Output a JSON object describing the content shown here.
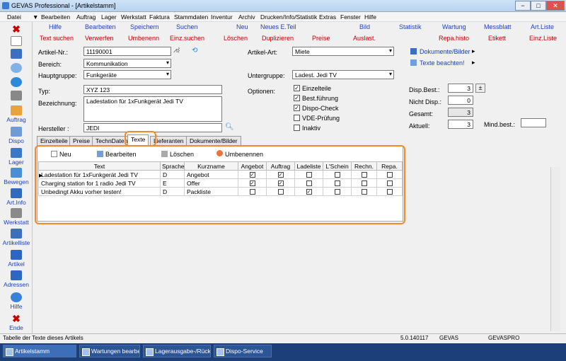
{
  "window": {
    "title": "GEVAS Professional - [Artikelstamm]",
    "min": "−",
    "max": "□",
    "close": "✕"
  },
  "menu": [
    "Datei",
    "▼",
    "Bearbeiten",
    "Auftrag",
    "Lager",
    "Werkstatt",
    "Faktura",
    "Stammdaten",
    "Inventur",
    "Archiv",
    "Drucken/Info/Statistik",
    "Extras",
    "Fenster",
    "Hilfe"
  ],
  "toolbar": {
    "row1": [
      "Hilfe",
      "Bearbeiten",
      "Speichern",
      "Suchen",
      "Neu",
      "Neues E.Teil",
      "Bild",
      "Statistik",
      "Wartung",
      "Messblatt",
      "Art.Liste"
    ],
    "row2": [
      "Text suchen",
      "Verwerfen",
      "Umbenenn",
      "Einz.suchen",
      "Löschen",
      "Duplizieren",
      "Preise",
      "Auslast.",
      "Repa.histo",
      "Etikett",
      "Einz.Liste"
    ]
  },
  "sidebar": [
    "Auftrag",
    "Dispo",
    "Lager",
    "Bewegen",
    "Art.Info",
    "Werkstatt",
    "Artikelliste",
    "Artikel",
    "Adressen",
    "Hilfe",
    "Ende"
  ],
  "form": {
    "artikelnr_label": "Artikel-Nr.:",
    "artikelnr": "11190001",
    "bereich_label": "Bereich:",
    "bereich": "Kommunikation",
    "hauptgruppe_label": "Hauptgruppe:",
    "hauptgruppe": "Funkgeräte",
    "typ_label": "Typ:",
    "typ": "XYZ 123",
    "bezeichnung_label": "Bezeichnung:",
    "bezeichnung": "Ladestation für 1xFunkgerät Jedi TV",
    "hersteller_label": "Hersteller :",
    "hersteller": "JEDI",
    "artikelart_label": "Artikel-Art:",
    "artikelart": "Miete",
    "untergruppe_label": "Untergruppe:",
    "untergruppe": "Ladest. Jedi TV",
    "optionen_label": "Optionen:",
    "dokumente": "Dokumente/Bilder",
    "texte_beachten": "Texte beachten!",
    "options": [
      {
        "label": "Einzelteile",
        "checked": "✓"
      },
      {
        "label": "Best.führung",
        "checked": "✓"
      },
      {
        "label": "Dispo-Check",
        "checked": "✓"
      },
      {
        "label": "VDE-Prüfung",
        "checked": ""
      },
      {
        "label": "Inaktiv",
        "checked": ""
      }
    ],
    "disp_best_label": "Disp.Best.:",
    "disp_best": "3",
    "plusminus": "±",
    "nicht_disp_label": "Nicht Disp.:",
    "nicht_disp": "0",
    "gesamt_label": "Gesamt:",
    "gesamt": "3",
    "aktuell_label": "Aktuell:",
    "aktuell": "3",
    "mind_best_label": "Mind.best.:",
    "mind_best": ""
  },
  "tabs": [
    "Einzelteile",
    "Preise",
    "TechnDaten",
    "Texte",
    "Lieferanten",
    "Dokumente/Bilder"
  ],
  "text_toolbar": [
    "Neu",
    "Bearbeiten",
    "Löschen",
    "Umbenennen"
  ],
  "grid": {
    "headers": [
      "Text",
      "Sprache",
      "Kurzname",
      "Angebot",
      "Auftrag",
      "Ladeliste",
      "L'Schein",
      "Rechn.",
      "Repa."
    ],
    "rows": [
      {
        "text": "Ladestation für 1xFunkgerät Jedi TV",
        "sprache": "D",
        "kurzname": "Angebot",
        "checks": [
          "✓",
          "✓",
          "",
          "",
          "",
          ""
        ]
      },
      {
        "text": "Charging station for 1 radio Jedi TV",
        "sprache": "E",
        "kurzname": "Offer",
        "checks": [
          "✓",
          "✓",
          "",
          "",
          "",
          ""
        ]
      },
      {
        "text": "Unbedingt Akku vorher testen!",
        "sprache": "D",
        "kurzname": "Packliste",
        "checks": [
          "",
          "",
          "✓",
          "",
          "",
          ""
        ]
      }
    ]
  },
  "status": {
    "text": "Tabelle der Texte dieses Artikels",
    "version": "5.0.140117",
    "app": "GEVAS",
    "db": "GEVASPRO"
  },
  "taskbar": [
    "Artikelstamm",
    "Wartungen bearbeiten",
    "Lagerausgabe-/Rückn...",
    "Dispo-Service"
  ],
  "colors": {
    "accent_red": "#c00000",
    "accent_blue": "#1f3fbf",
    "highlight": "#f28a2c"
  }
}
